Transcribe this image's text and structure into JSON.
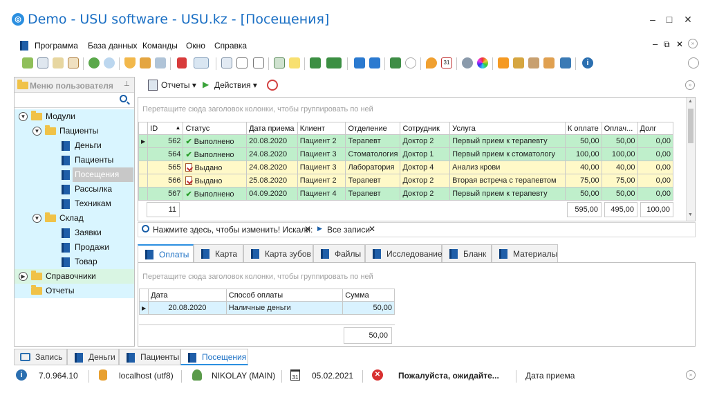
{
  "window": {
    "title": "Demo - USU software - USU.kz - [Посещения]",
    "logo": "usu-logo-icon"
  },
  "menu": [
    "Программа",
    "База данных",
    "Команды",
    "Окно",
    "Справка"
  ],
  "left_panel": {
    "title": "Меню пользователя",
    "tree": [
      {
        "label": "Модули",
        "level": 0,
        "type": "folder",
        "expanded": true
      },
      {
        "label": "Пациенты",
        "level": 1,
        "type": "folder",
        "expanded": true
      },
      {
        "label": "Деньги",
        "level": 2,
        "type": "book"
      },
      {
        "label": "Пациенты",
        "level": 2,
        "type": "book"
      },
      {
        "label": "Посещения",
        "level": 2,
        "type": "book",
        "selected": true
      },
      {
        "label": "Рассылка",
        "level": 2,
        "type": "book"
      },
      {
        "label": "Техникам",
        "level": 2,
        "type": "book"
      },
      {
        "label": "Склад",
        "level": 1,
        "type": "folder",
        "expanded": true
      },
      {
        "label": "Заявки",
        "level": 2,
        "type": "book"
      },
      {
        "label": "Продажи",
        "level": 2,
        "type": "book"
      },
      {
        "label": "Товар",
        "level": 2,
        "type": "book"
      },
      {
        "label": "Справочники",
        "level": 0,
        "type": "folder",
        "expanded": false
      },
      {
        "label": "Отчеты",
        "level": 0,
        "type": "folder",
        "expanded": false
      }
    ]
  },
  "main_toolbar": {
    "reports": "Отчеты",
    "actions": "Действия"
  },
  "grid": {
    "group_hint": "Перетащите сюда заголовок колонки, чтобы группировать по ней",
    "columns": [
      "ID",
      "Статус",
      "Дата приема",
      "Клиент",
      "Отделение",
      "Сотрудник",
      "Услуга",
      "К оплате",
      "Оплач...",
      "Долг"
    ],
    "rows": [
      {
        "id": "562",
        "status": "Выполнено",
        "status_kind": "done",
        "date": "20.08.2020",
        "client": "Пациент 2",
        "dept": "Терапевт",
        "staff": "Доктор 2",
        "service": "Первый прием к терапевту",
        "to_pay": "50,00",
        "paid": "50,00",
        "debt": "0,00"
      },
      {
        "id": "564",
        "status": "Выполнено",
        "status_kind": "done",
        "date": "24.08.2020",
        "client": "Пациент 3",
        "dept": "Стоматология",
        "staff": "Доктор 1",
        "service": "Первый прием к стоматологу",
        "to_pay": "100,00",
        "paid": "100,00",
        "debt": "0,00"
      },
      {
        "id": "565",
        "status": "Выдано",
        "status_kind": "issued",
        "date": "24.08.2020",
        "client": "Пациент 3",
        "dept": "Лаборатория",
        "staff": "Доктор 4",
        "service": "Анализ крови",
        "to_pay": "40,00",
        "paid": "40,00",
        "debt": "0,00"
      },
      {
        "id": "566",
        "status": "Выдано",
        "status_kind": "issued",
        "date": "25.08.2020",
        "client": "Пациент 2",
        "dept": "Терапевт",
        "staff": "Доктор 2",
        "service": "Вторая встреча с терапевтом",
        "to_pay": "75,00",
        "paid": "75,00",
        "debt": "0,00"
      },
      {
        "id": "567",
        "status": "Выполнено",
        "status_kind": "done",
        "date": "04.09.2020",
        "client": "Пациент 4",
        "dept": "Терапевт",
        "staff": "Доктор 2",
        "service": "Первый прием к терапевту",
        "to_pay": "50,00",
        "paid": "50,00",
        "debt": "0,00"
      }
    ],
    "footer": {
      "count": "11",
      "to_pay": "595,00",
      "paid": "495,00",
      "debt": "100,00"
    }
  },
  "filter": {
    "hint": "Нажмите здесь, чтобы изменить! Искали:",
    "value": "Все записи"
  },
  "detail_tabs": [
    "Оплаты",
    "Карта",
    "Карта зубов",
    "Файлы",
    "Исследование",
    "Бланк",
    "Материалы"
  ],
  "detail": {
    "group_hint": "Перетащите сюда заголовок колонки, чтобы группировать по ней",
    "columns": [
      "Дата",
      "Способ оплаты",
      "Сумма"
    ],
    "rows": [
      {
        "date": "20.08.2020",
        "method": "Наличные деньги",
        "sum": "50,00"
      }
    ],
    "total": "50,00"
  },
  "bottom_tabs": [
    "Запись",
    "Деньги",
    "Пациенты",
    "Посещения"
  ],
  "status": {
    "version": "7.0.964.10",
    "db": "localhost (utf8)",
    "user": "NIKOLAY (MAIN)",
    "date": "05.02.2021",
    "message": "Пожалуйста, ожидайте...",
    "field": "Дата приема"
  },
  "colors": {
    "accent": "#2b8fe0",
    "row_done": "#bfefcb",
    "row_issued": "#fff9c8",
    "tree_bg": "#d9f5ff"
  }
}
